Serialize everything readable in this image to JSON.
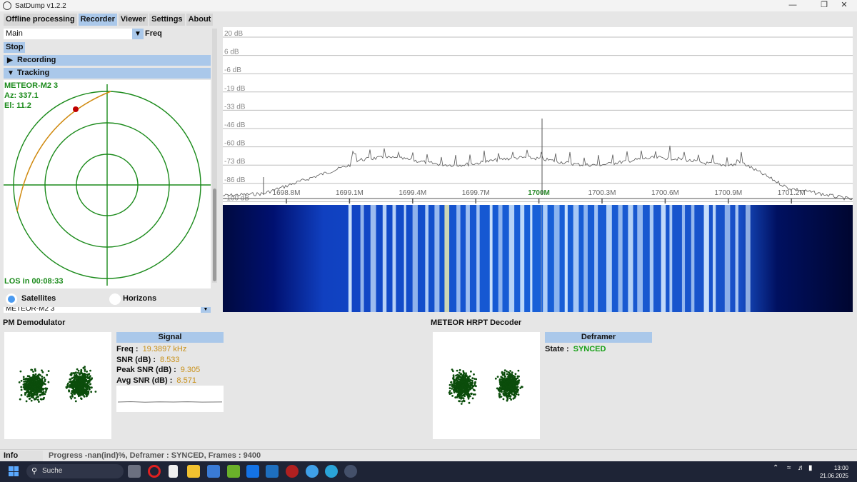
{
  "window": {
    "title": "SatDump v1.2.2"
  },
  "tabs": [
    "Offline processing",
    "Recorder",
    "Viewer",
    "Settings",
    "About"
  ],
  "recorder": {
    "source_select": "Main",
    "freq_label": "Freq",
    "stop_label": "Stop",
    "sections": {
      "recording": "Recording",
      "tracking": "Tracking"
    }
  },
  "tracking": {
    "satellite": "METEOR-M2 3",
    "az": "Az: 337.1",
    "el": "El: 11.2",
    "los": "LOS in 00:08:33",
    "mode_satellites": "Satellites",
    "mode_horizons": "Horizons",
    "selected_satellite": "METEOR-M2 3"
  },
  "spectrum": {
    "db_labels": [
      "20 dB",
      "6 dB",
      "-6 dB",
      "-19 dB",
      "-33 dB",
      "-46 dB",
      "-60 dB",
      "-73 dB",
      "-86 dB",
      "-100 dB"
    ],
    "freq_labels": [
      "1698.8M",
      "1699.1M",
      "1699.4M",
      "1699.7M",
      "1700M",
      "1700.3M",
      "1700.6M",
      "1700.9M",
      "1701.2M"
    ],
    "center_freq": "1700M"
  },
  "pm_demod": {
    "title": "PM Demodulator",
    "signal_header": "Signal",
    "freq_label": "Freq :",
    "freq_value": "19.3897 kHz",
    "snr_label": "SNR (dB) :",
    "snr_value": "8.533",
    "peak_snr_label": "Peak SNR (dB) :",
    "peak_snr_value": "9.305",
    "avg_snr_label": "Avg SNR (dB) :",
    "avg_snr_value": "8.571"
  },
  "hrpt_decoder": {
    "title": "METEOR HRPT Decoder",
    "deframer_header": "Deframer",
    "state_label": "State :",
    "state_value": "SYNCED"
  },
  "status": {
    "info_label": "Info",
    "message": "Progress -nan(ind)%, Deframer : SYNCED, Frames : 9400"
  },
  "taskbar": {
    "search_placeholder": "Suche",
    "time": "13:00",
    "date": "21.06.2025"
  },
  "colors": {
    "accent": "#aac8ea",
    "polar_green": "#1a8a1a",
    "value_orange": "#c9911a",
    "synced_green": "#17a017"
  }
}
